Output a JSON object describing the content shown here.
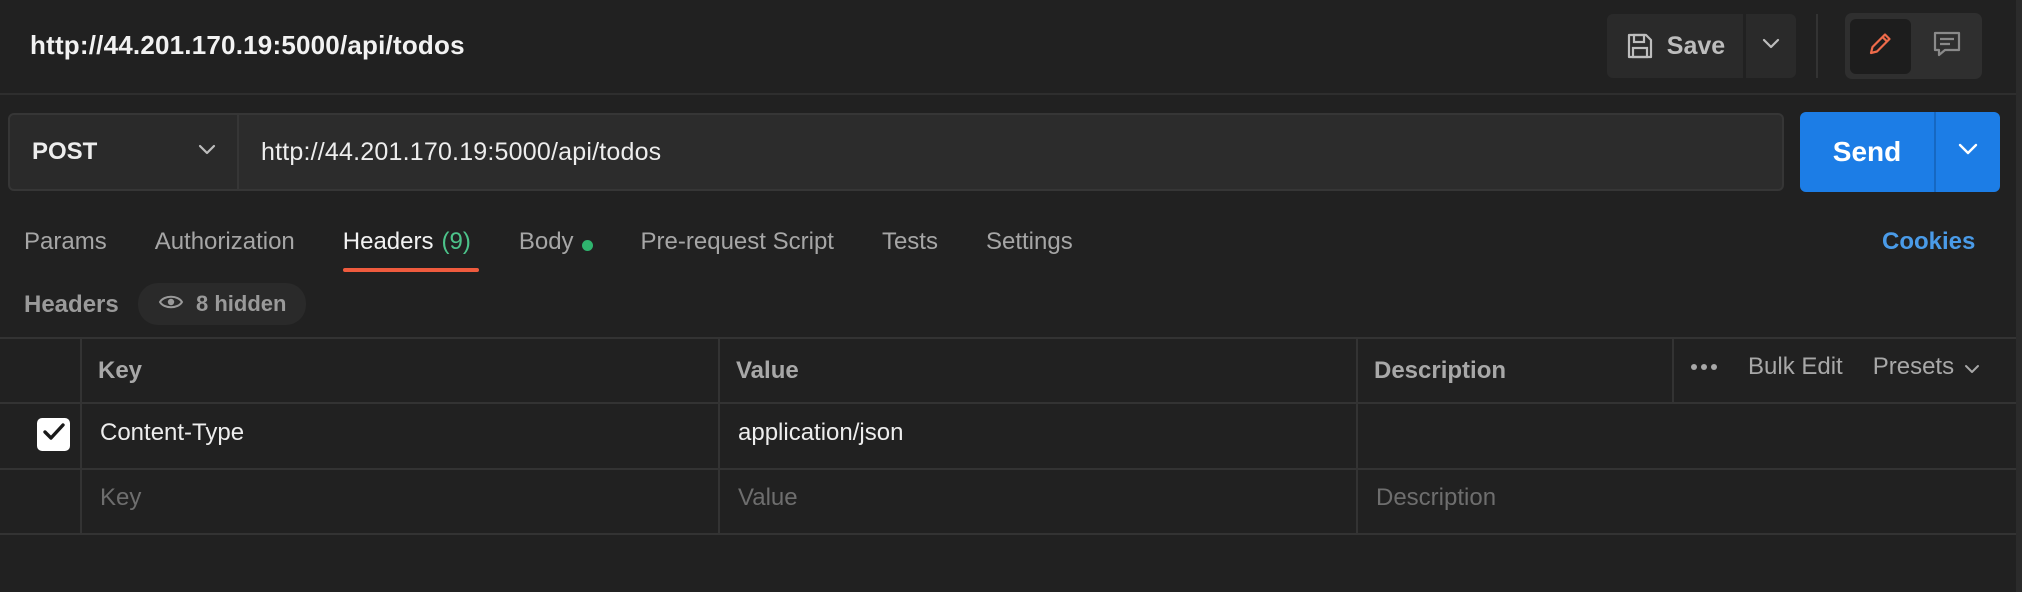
{
  "header": {
    "title": "http://44.201.170.19:5000/api/todos",
    "save_label": "Save"
  },
  "request": {
    "method": "POST",
    "url": "http://44.201.170.19:5000/api/todos",
    "send_label": "Send"
  },
  "tabs": [
    {
      "label": "Params"
    },
    {
      "label": "Authorization"
    },
    {
      "label": "Headers",
      "count": "(9)",
      "active": true
    },
    {
      "label": "Body"
    },
    {
      "label": "Pre-request Script"
    },
    {
      "label": "Tests"
    },
    {
      "label": "Settings"
    }
  ],
  "cookies_label": "Cookies",
  "headers_section": {
    "label": "Headers",
    "hidden_label": "8 hidden"
  },
  "table": {
    "columns": {
      "key": "Key",
      "value": "Value",
      "description": "Description"
    },
    "bulk_edit_label": "Bulk Edit",
    "presets_label": "Presets",
    "rows": [
      {
        "checked": true,
        "key": "Content-Type",
        "value": "application/json",
        "description": ""
      }
    ],
    "placeholders": {
      "key": "Key",
      "value": "Value",
      "description": "Description"
    }
  },
  "colors": {
    "background": "#212121",
    "accent_send": "#1c7de6",
    "active_tab_underline": "#ef5b3e",
    "count_green": "#4cc38a",
    "body_dot": "#2fb46e",
    "cookies_link": "#4a9be8"
  },
  "icons": {
    "save": "floppy-disk-icon",
    "edit": "pencil-icon",
    "comments": "comment-icon",
    "hidden": "eye-icon",
    "more": "ellipsis-icon"
  }
}
